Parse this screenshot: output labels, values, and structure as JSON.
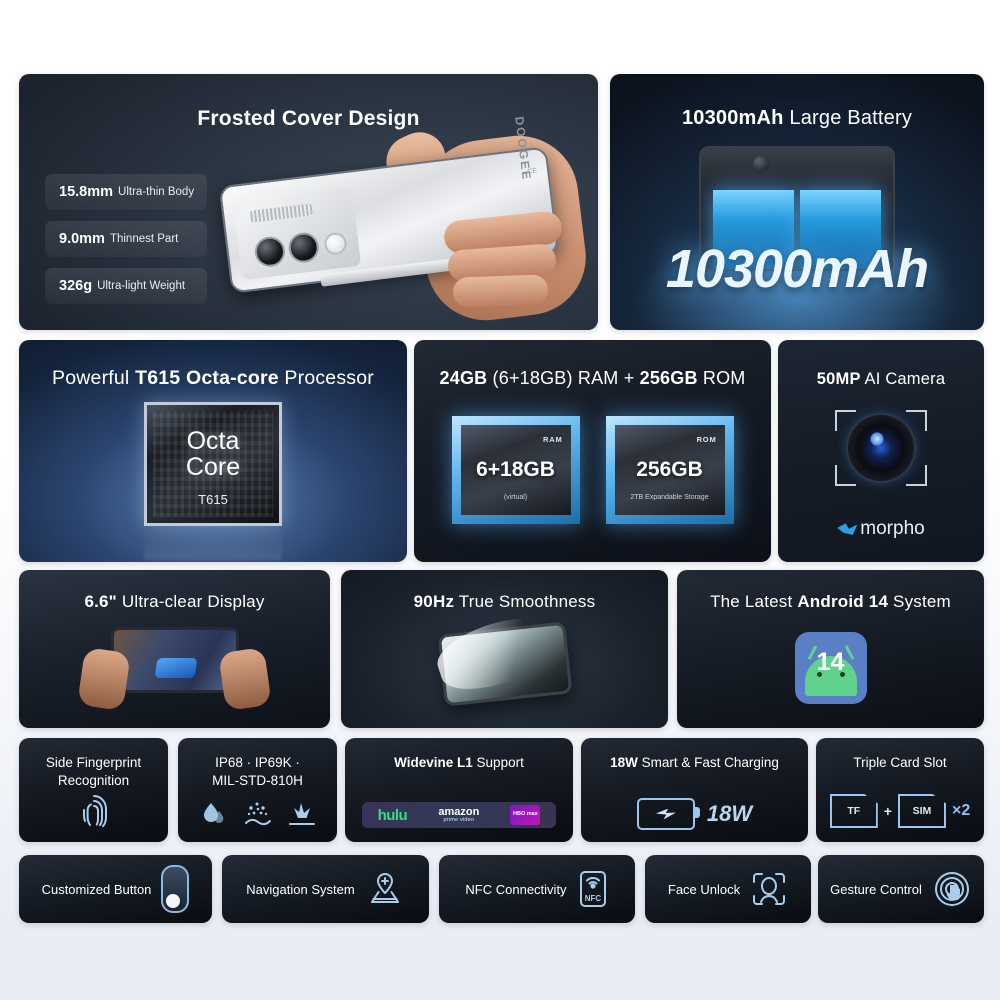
{
  "cards": {
    "frosted": {
      "title_bold": "Frosted Cover Design",
      "specs": [
        {
          "value": "15.8mm",
          "label": "Ultra-thin Body"
        },
        {
          "value": "9.0mm",
          "label": "Thinnest Part"
        },
        {
          "value": "326g",
          "label": "Ultra-light Weight"
        }
      ],
      "phone_brand": "DOOGEE",
      "phone_ce": "CE"
    },
    "battery": {
      "title_bold": "10300mAh",
      "title_rest": " Large Battery",
      "big_number": "10300mAh"
    },
    "cpu": {
      "title_pre": "Powerful ",
      "title_bold": "T615 Octa-core",
      "title_post": " Processor",
      "chip_line1": "Octa",
      "chip_line2": "Core",
      "chip_model": "T615"
    },
    "ram": {
      "title_b1": "24GB",
      "title_m": " (6+18GB) RAM + ",
      "title_b2": "256GB",
      "title_post": " ROM",
      "ram_chip": {
        "tag": "RAM",
        "value": "6+18GB",
        "sub": "(virtual)"
      },
      "rom_chip": {
        "tag": "ROM",
        "value": "256GB",
        "sub": "2TB Expandable Storage"
      }
    },
    "camera": {
      "title_bold": "50MP",
      "title_rest": " AI Camera",
      "partner_logo": "morpho"
    },
    "display": {
      "title_bold": "6.6\"",
      "title_rest": " Ultra-clear Display"
    },
    "refresh": {
      "title_bold": "90Hz",
      "title_rest": " True Smoothness"
    },
    "android": {
      "title_pre": "The Latest ",
      "title_bold": "Android 14",
      "title_post": " System",
      "badge_number": "14"
    },
    "fingerprint": {
      "line1": "Side Fingerprint",
      "line2": "Recognition"
    },
    "rugged": {
      "line1": "IP68 · IP69K ·",
      "line2": "MIL-STD-810H"
    },
    "widevine": {
      "title_bold": "Widevine L1",
      "title_rest": " Support",
      "logos": [
        "hulu",
        "amazon",
        "prime video",
        "HBO max"
      ]
    },
    "charging": {
      "title_bold": "18W",
      "title_rest": " Smart & Fast Charging",
      "icon_label": "18W"
    },
    "cardslot": {
      "title": "Triple Card Slot",
      "slot1": "TF",
      "plus": "+",
      "slot2": "SIM",
      "multiplier": "×2"
    },
    "custom_button": {
      "label": "Customized Button"
    },
    "navigation": {
      "label": "Navigation System"
    },
    "nfc": {
      "label": "NFC Connectivity",
      "icon_text": "NFC"
    },
    "face_unlock": {
      "label": "Face Unlock"
    },
    "gesture": {
      "label": "Gesture Control"
    }
  },
  "colors": {
    "accent_blue": "#9cc6ef",
    "card_dark": "#161c25",
    "page_bg_top": "#ffffff",
    "page_bg_bottom": "#e9ecf5",
    "android_green": "#5fd38d",
    "android_tile": "#5b7fc4",
    "hulu_green": "#31e07e"
  }
}
